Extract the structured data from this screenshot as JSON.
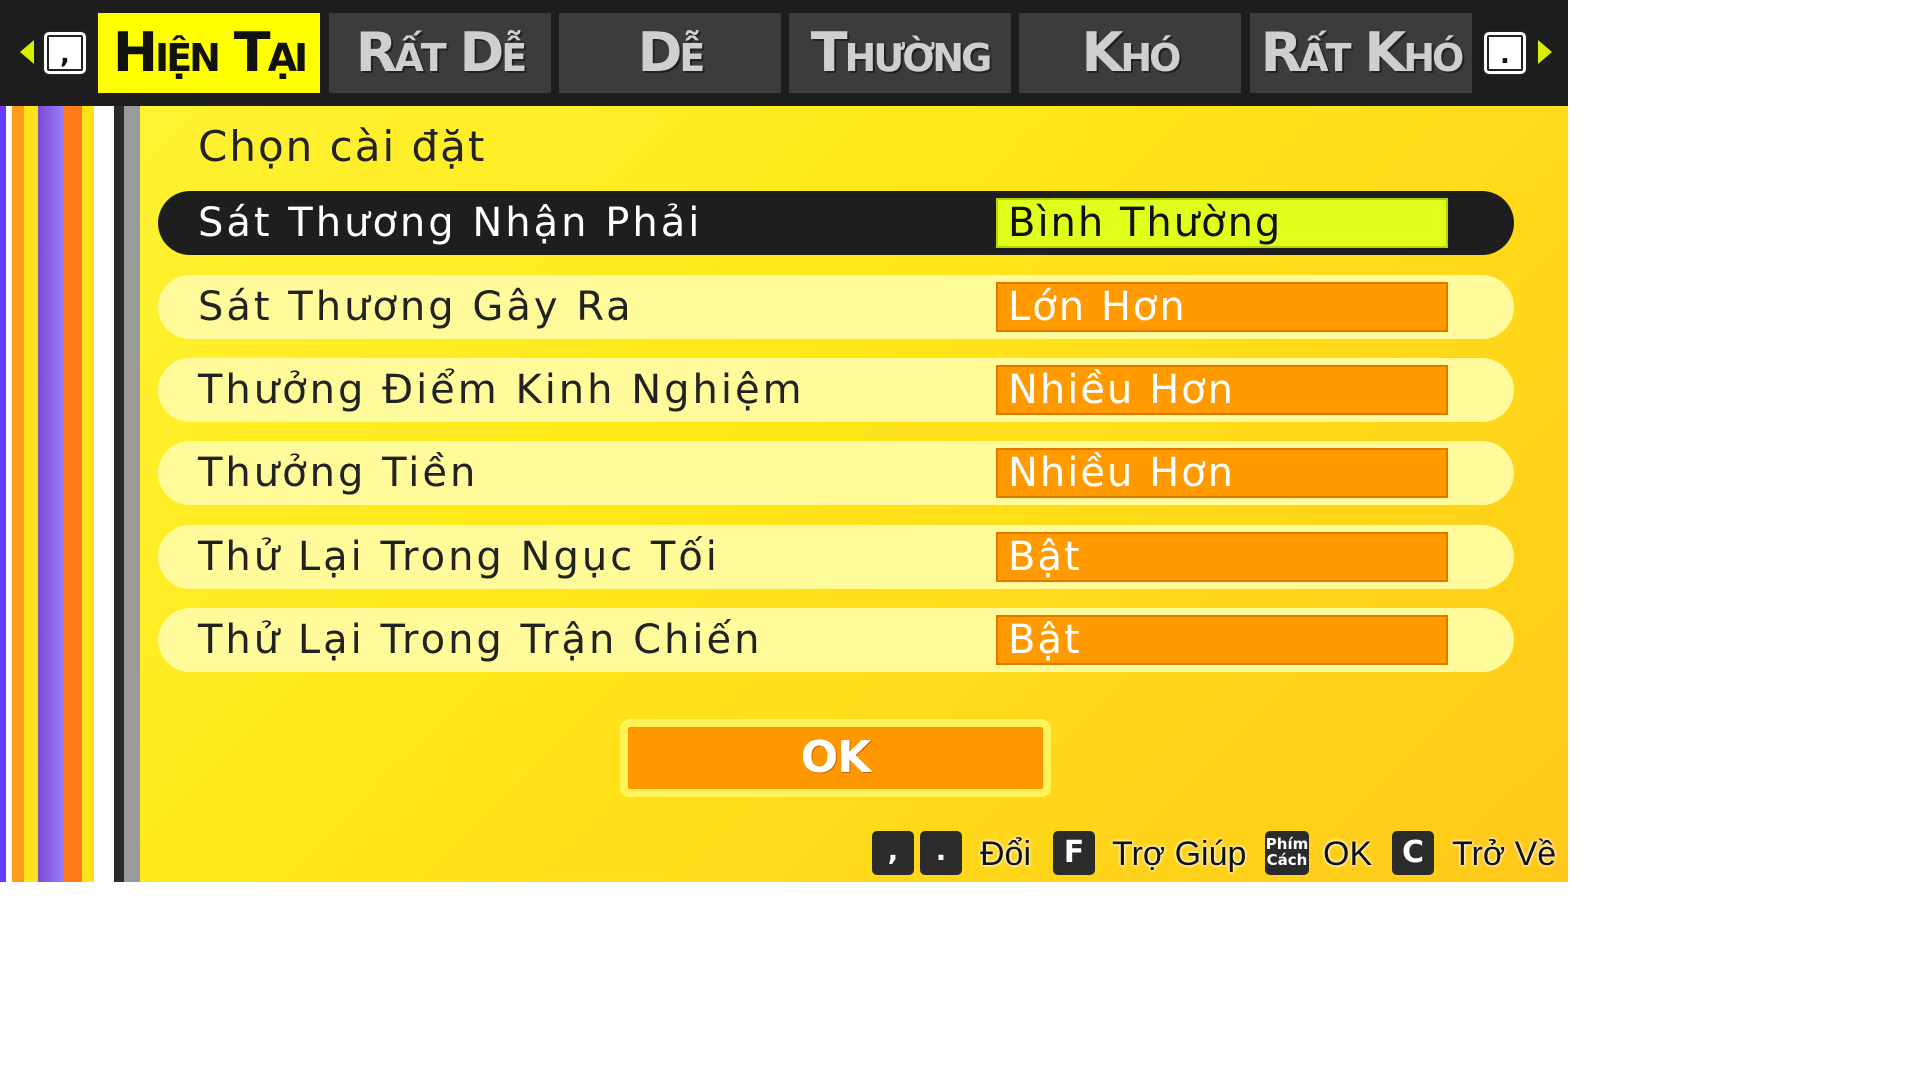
{
  "tabs": {
    "prev_key": ",",
    "next_key": ".",
    "items": [
      {
        "label": "Hiện Tại",
        "active": true
      },
      {
        "label": "Rất Dễ",
        "active": false
      },
      {
        "label": "Dễ",
        "active": false
      },
      {
        "label": "Thường",
        "active": false
      },
      {
        "label": "Khó",
        "active": false
      },
      {
        "label": "Rất Khó",
        "active": false
      }
    ]
  },
  "panel": {
    "title": "Chọn cài đặt",
    "settings": [
      {
        "label": "Sát Thương Nhận Phải",
        "value": "Bình Thường",
        "selected": true
      },
      {
        "label": "Sát Thương Gây Ra",
        "value": "Lớn Hơn",
        "selected": false
      },
      {
        "label": "Thưởng Điểm Kinh Nghiệm",
        "value": "Nhiều Hơn",
        "selected": false
      },
      {
        "label": "Thưởng Tiền",
        "value": "Nhiều Hơn",
        "selected": false
      },
      {
        "label": "Thử Lại Trong Ngục Tối",
        "value": "Bật",
        "selected": false
      },
      {
        "label": "Thử Lại Trong Trận Chiến",
        "value": "Bật",
        "selected": false
      }
    ],
    "ok_label": "OK"
  },
  "footer": {
    "switch_keys": [
      ",",
      "."
    ],
    "switch_label": "Đổi",
    "help_key": "F",
    "help_label": "Trợ Giúp",
    "ok_key_line1": "Phím",
    "ok_key_line2": "Cách",
    "ok_label": "OK",
    "back_key": "C",
    "back_label": "Trở Về"
  },
  "colors": {
    "active_tab": "#ffff00",
    "inactive_tab": "#3c3c3c",
    "value_box": "#ff9a00",
    "selected_value_box": "#e0ff1a",
    "row_bg": "#fffb9a",
    "selected_row_bg": "#1e1e1e"
  }
}
